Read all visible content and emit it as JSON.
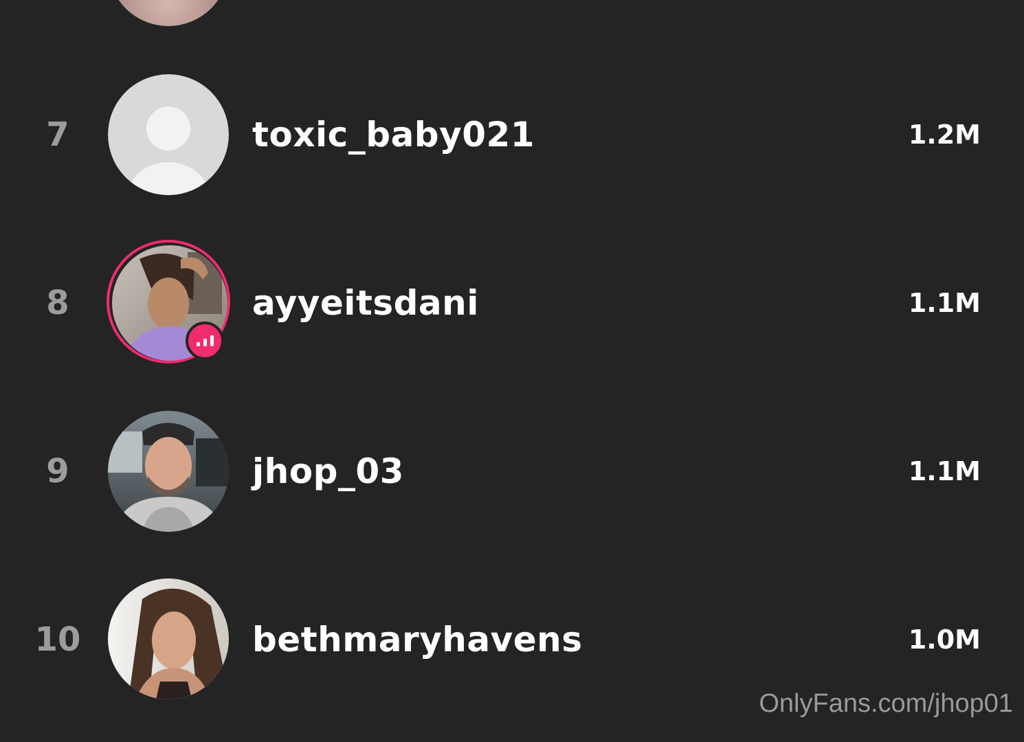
{
  "ranking": {
    "rows": [
      {
        "rank": "7",
        "username": "toxic_baby021",
        "count": "1.2M",
        "avatar": "default-avatar-icon",
        "live": false
      },
      {
        "rank": "8",
        "username": "ayyeitsdani",
        "count": "1.1M",
        "avatar": "profile-photo",
        "live": true
      },
      {
        "rank": "9",
        "username": "jhop_03",
        "count": "1.1M",
        "avatar": "profile-photo",
        "live": false
      },
      {
        "rank": "10",
        "username": "bethmaryhavens",
        "count": "1.0M",
        "avatar": "profile-photo",
        "live": false
      }
    ]
  },
  "watermark": "OnlyFans.com/jhop01",
  "colors": {
    "background": "#242424",
    "rank_text": "#9c9c9c",
    "live_accent": "#ef2c6d",
    "watermark_text": "#9a9a9a"
  },
  "icons": {
    "live_indicator": "live-bars-icon",
    "default_avatar": "default-avatar-icon"
  }
}
